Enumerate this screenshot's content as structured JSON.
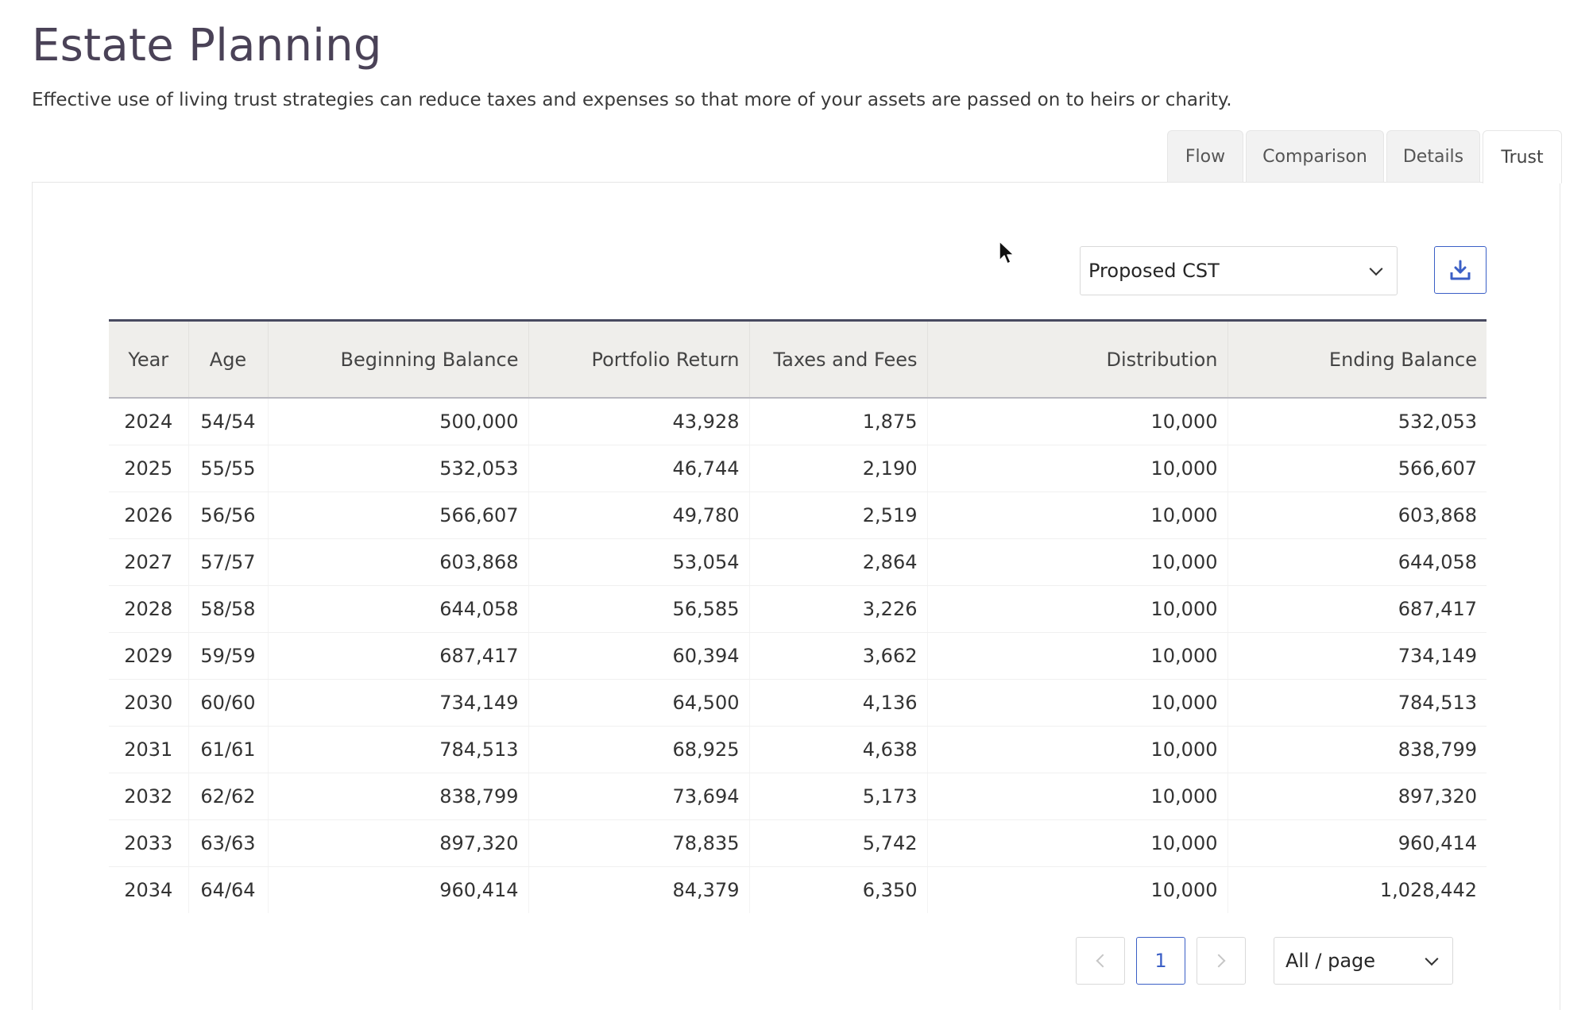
{
  "header": {
    "title": "Estate Planning",
    "subtitle": "Effective use of living trust strategies can reduce taxes and expenses so that more of your assets are passed on to heirs or charity."
  },
  "tabs": [
    {
      "label": "Flow",
      "active": false
    },
    {
      "label": "Comparison",
      "active": false
    },
    {
      "label": "Details",
      "active": false
    },
    {
      "label": "Trust",
      "active": true
    }
  ],
  "controls": {
    "scenario_select_value": "Proposed CST",
    "download_icon": "download-icon"
  },
  "table": {
    "columns": [
      "Year",
      "Age",
      "Beginning Balance",
      "Portfolio Return",
      "Taxes and Fees",
      "Distribution",
      "Ending Balance"
    ],
    "rows": [
      [
        "2024",
        "54/54",
        "500,000",
        "43,928",
        "1,875",
        "10,000",
        "532,053"
      ],
      [
        "2025",
        "55/55",
        "532,053",
        "46,744",
        "2,190",
        "10,000",
        "566,607"
      ],
      [
        "2026",
        "56/56",
        "566,607",
        "49,780",
        "2,519",
        "10,000",
        "603,868"
      ],
      [
        "2027",
        "57/57",
        "603,868",
        "53,054",
        "2,864",
        "10,000",
        "644,058"
      ],
      [
        "2028",
        "58/58",
        "644,058",
        "56,585",
        "3,226",
        "10,000",
        "687,417"
      ],
      [
        "2029",
        "59/59",
        "687,417",
        "60,394",
        "3,662",
        "10,000",
        "734,149"
      ],
      [
        "2030",
        "60/60",
        "734,149",
        "64,500",
        "4,136",
        "10,000",
        "784,513"
      ],
      [
        "2031",
        "61/61",
        "784,513",
        "68,925",
        "4,638",
        "10,000",
        "838,799"
      ],
      [
        "2032",
        "62/62",
        "838,799",
        "73,694",
        "5,173",
        "10,000",
        "897,320"
      ],
      [
        "2033",
        "63/63",
        "897,320",
        "78,835",
        "5,742",
        "10,000",
        "960,414"
      ],
      [
        "2034",
        "64/64",
        "960,414",
        "84,379",
        "6,350",
        "10,000",
        "1,028,442"
      ]
    ]
  },
  "pagination": {
    "current_page": "1",
    "page_size_value": "All / page"
  },
  "colors": {
    "accent": "#3b5fc6",
    "title": "#4a4257",
    "header_bg": "#efeeeb",
    "header_rule": "#484a60"
  }
}
